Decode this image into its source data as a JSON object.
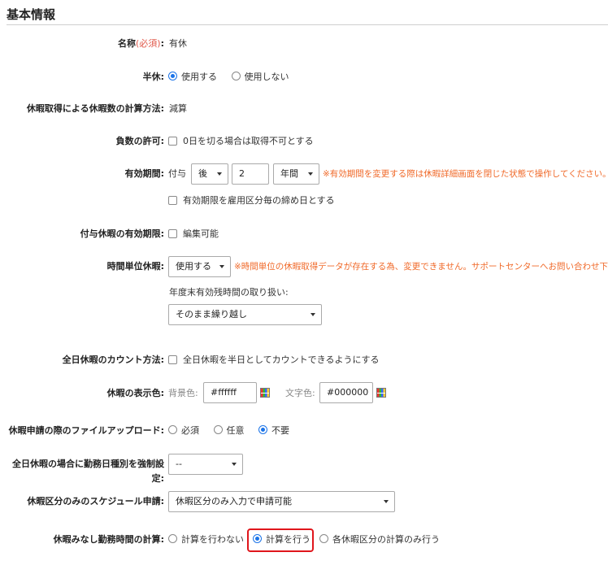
{
  "section": {
    "title": "基本情報"
  },
  "name_row": {
    "label": "名称",
    "required": "(必須)",
    "colon": ":",
    "value": "有休"
  },
  "half_day": {
    "label": "半休:",
    "options": [
      "使用する",
      "使用しない"
    ]
  },
  "calc_method": {
    "label": "休暇取得による休暇数の計算方法:",
    "value": "減算"
  },
  "negative": {
    "label": "負数の許可:",
    "checkbox_label": "0日を切る場合は取得不可とする"
  },
  "validity": {
    "label": "有効期間:",
    "prefix": "付与",
    "when_select": "後",
    "number": "2",
    "unit_select": "年間",
    "warning": "※有効期間を変更する際は休暇詳細画面を閉じた状態で操作してください。",
    "checkbox_label": "有効期限を雇用区分毎の締め日とする"
  },
  "granted_validity": {
    "label": "付与休暇の有効期限:",
    "checkbox_label": "編集可能"
  },
  "hourly": {
    "label": "時間単位休暇:",
    "select": "使用する",
    "warning": "※時間単位の休暇取得データが存在する為、変更できません。サポートセンターへお問い合わせ下さい。",
    "sub_label": "年度末有効残時間の取り扱い:",
    "sub_select": "そのまま繰り越し"
  },
  "full_day_count": {
    "label": "全日休暇のカウント方法:",
    "checkbox_label": "全日休暇を半日としてカウントできるようにする"
  },
  "display_color": {
    "label": "休暇の表示色:",
    "bg_label": "背景色:",
    "bg_value": "#ffffff",
    "text_label": "文字色:",
    "text_value": "#000000"
  },
  "file_upload": {
    "label": "休暇申請の際のファイルアップロード:",
    "options": [
      "必須",
      "任意",
      "不要"
    ]
  },
  "force_day_type": {
    "label_line1": "全日休暇の場合に勤務日種別を強制設",
    "label_line2": "定:",
    "select": "--"
  },
  "schedule_apply": {
    "label": "休暇区分のみのスケジュール申請:",
    "select": "休暇区分のみ入力で申請可能"
  },
  "deemed_hours": {
    "label": "休暇みなし勤務時間の計算:",
    "options": [
      "計算を行わない",
      "計算を行う",
      "各休暇区分の計算のみ行う"
    ]
  },
  "colors": {
    "radio_selected": "#1a73e8",
    "warning": "#f06a2a",
    "required": "#e0584a",
    "highlight": "#e0161c"
  }
}
